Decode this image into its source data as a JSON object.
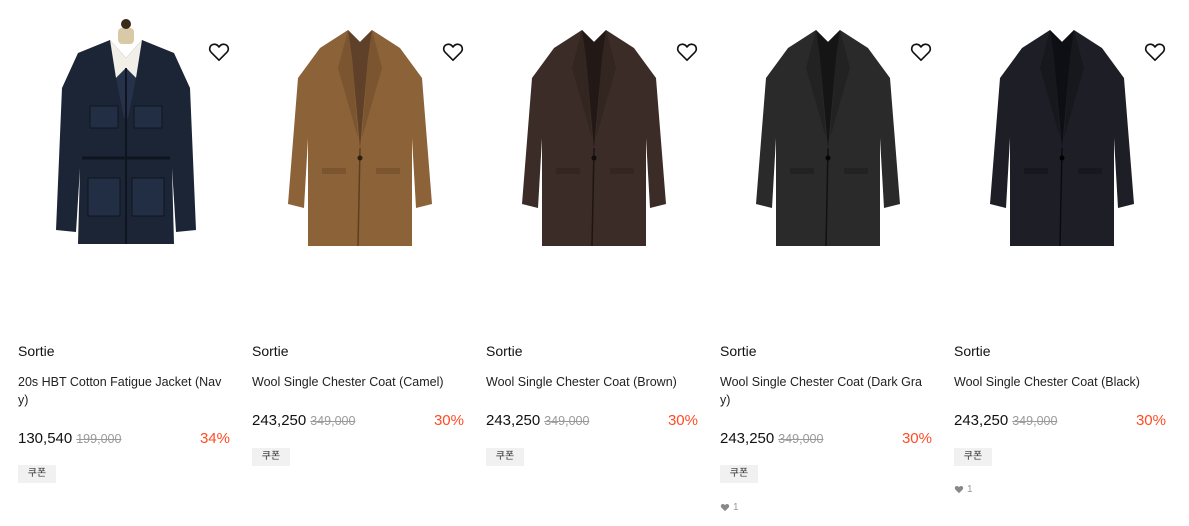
{
  "products": [
    {
      "brand": "Sortie",
      "name": "20s HBT Cotton Fatigue Jacket (Navy)",
      "price": "130,540",
      "original_price": "199,000",
      "discount": "34%",
      "coupon": "쿠폰",
      "likes": "",
      "garment_color": "#1b2536",
      "garment_type": "jacket"
    },
    {
      "brand": "Sortie",
      "name": "Wool Single Chester Coat (Camel)",
      "price": "243,250",
      "original_price": "349,000",
      "discount": "30%",
      "coupon": "쿠폰",
      "likes": "",
      "garment_color": "#8c6238",
      "garment_type": "coat"
    },
    {
      "brand": "Sortie",
      "name": "Wool Single Chester Coat (Brown)",
      "price": "243,250",
      "original_price": "349,000",
      "discount": "30%",
      "coupon": "쿠폰",
      "likes": "",
      "garment_color": "#3b2c27",
      "garment_type": "coat"
    },
    {
      "brand": "Sortie",
      "name": "Wool Single Chester Coat (Dark Gray)",
      "price": "243,250",
      "original_price": "349,000",
      "discount": "30%",
      "coupon": "쿠폰",
      "likes": "1",
      "garment_color": "#2a2a2a",
      "garment_type": "coat"
    },
    {
      "brand": "Sortie",
      "name": "Wool Single Chester Coat (Black)",
      "price": "243,250",
      "original_price": "349,000",
      "discount": "30%",
      "coupon": "쿠폰",
      "likes": "1",
      "garment_color": "#1e1f26",
      "garment_type": "coat"
    }
  ],
  "colors": {
    "discount": "#ff4b24",
    "coupon_bg": "#f1f1f1"
  },
  "icons": {
    "wishlist": "heart-outline-icon",
    "likes": "heart-filled-icon"
  }
}
